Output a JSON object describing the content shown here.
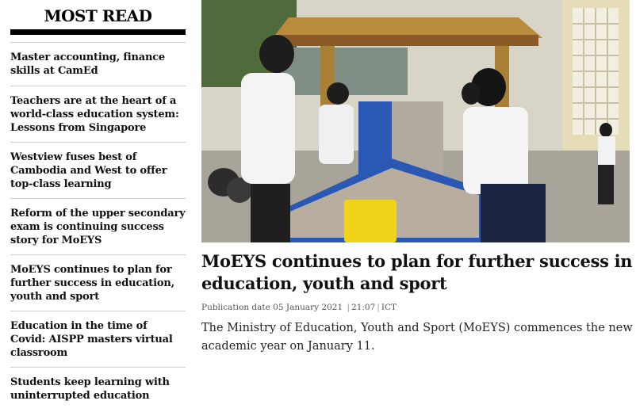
{
  "sidebar": {
    "title": "MOST READ",
    "items": [
      {
        "label": "Master accounting, finance skills at CamEd"
      },
      {
        "label": "Teachers are at the heart of a world-class education system: Lessons from Singapore"
      },
      {
        "label": "Westview fuses best of Cambodia and West to offer top-class learning"
      },
      {
        "label": "Reform of the upper secondary exam is continuing success story for MoEYS"
      },
      {
        "label": "MoEYS continues to plan for further success in education, youth and sport"
      },
      {
        "label": "Education in the time of Covid: AISPP masters virtual classroom"
      },
      {
        "label": "Students keep learning with uninterrupted education"
      }
    ]
  },
  "article": {
    "headline": "MoEYS continues to plan for further success in education, youth and sport",
    "meta": {
      "label": "Publication date",
      "date": "05 January 2021",
      "time": "21:07",
      "tz": "ICT"
    },
    "lede": "The Ministry of Education, Youth and Sport (MoEYS) commences the new academic year on January 11."
  }
}
